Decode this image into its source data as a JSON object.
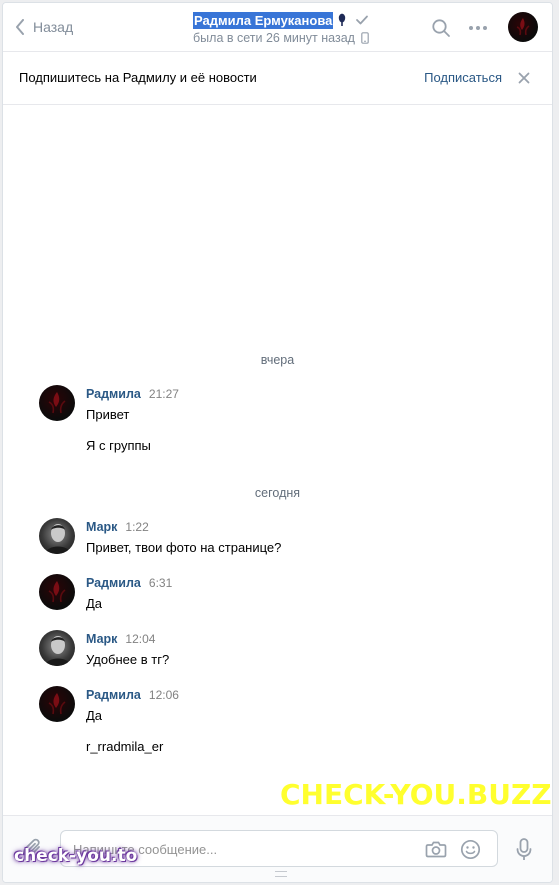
{
  "header": {
    "back_label": "Назад",
    "peer_name": "Радмила Ермуканова",
    "peer_status": "была в сети 26 минут назад"
  },
  "subscribe_bar": {
    "text": "Подпишитесь на Радмилу и её новости",
    "button": "Подписаться"
  },
  "days": [
    "вчера",
    "сегодня"
  ],
  "messages": [
    {
      "author": "Радмила",
      "time": "21:27",
      "lines": [
        "Привет",
        "Я с группы"
      ]
    },
    {
      "author": "Марк",
      "time": "1:22",
      "lines": [
        "Привет, твои фото на странице?"
      ]
    },
    {
      "author": "Радмила",
      "time": "6:31",
      "lines": [
        "Да"
      ]
    },
    {
      "author": "Марк",
      "time": "12:04",
      "lines": [
        "Удобнее в тг?"
      ]
    },
    {
      "author": "Радмила",
      "time": "12:06",
      "lines": [
        "Да",
        "r_rradmila_er"
      ]
    }
  ],
  "composer": {
    "placeholder": "Напишите сообщение..."
  },
  "watermarks": {
    "big": "CHECK-YOU.BUZZ",
    "small": "check-you.to"
  },
  "colors": {
    "accent": "#2a5885",
    "muted": "#818c99",
    "selection": "#3875d7",
    "watermark_big": "#ffff2e"
  }
}
